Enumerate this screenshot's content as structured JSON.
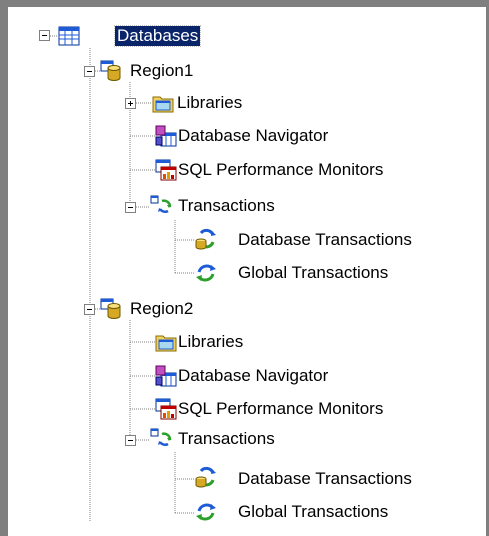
{
  "tree": {
    "root": {
      "label": "Databases",
      "icon": "database-table-icon",
      "expanded": true,
      "selected": true
    },
    "regions": [
      {
        "label": "Region1",
        "icon": "database-cylinder-icon",
        "expanded": true,
        "children": {
          "libraries": {
            "label": "Libraries",
            "icon": "folder-icon",
            "expandable": true,
            "expanded": false
          },
          "navigator": {
            "label": "Database Navigator",
            "icon": "database-navigator-icon"
          },
          "sql_monitors": {
            "label": "SQL Performance Monitors",
            "icon": "sql-performance-monitor-icon"
          },
          "transactions": {
            "label": "Transactions",
            "icon": "transactions-icon",
            "expanded": true,
            "children": {
              "database_transactions": {
                "label": "Database Transactions",
                "icon": "database-transactions-icon"
              },
              "global_transactions": {
                "label": "Global Transactions",
                "icon": "global-transactions-icon"
              }
            }
          }
        }
      },
      {
        "label": "Region2",
        "icon": "database-cylinder-icon",
        "expanded": true,
        "children": {
          "libraries": {
            "label": "Libraries",
            "icon": "folder-icon",
            "expandable": false
          },
          "navigator": {
            "label": "Database Navigator",
            "icon": "database-navigator-icon"
          },
          "sql_monitors": {
            "label": "SQL Performance Monitors",
            "icon": "sql-performance-monitor-icon"
          },
          "transactions": {
            "label": "Transactions",
            "icon": "transactions-icon",
            "expanded": true,
            "children": {
              "database_transactions": {
                "label": "Database Transactions",
                "icon": "database-transactions-icon"
              },
              "global_transactions": {
                "label": "Global Transactions",
                "icon": "global-transactions-icon"
              }
            }
          }
        }
      }
    ]
  },
  "colors": {
    "frame": "#7f7f7f",
    "selection": "#0a246a",
    "tree_lines": "#808080"
  }
}
